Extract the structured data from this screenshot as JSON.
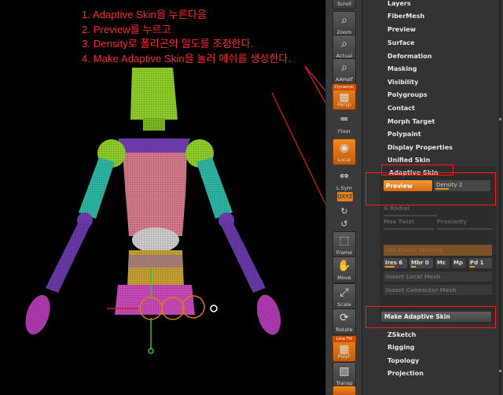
{
  "instructions": [
    "1. Adaptive Skin을 누른다음",
    "2. Preview를 누르고",
    "3. Density로 폴리곤의 밀도를 조정한다.",
    "4. Make Adaptive Skin을 눌러 메쉬를 생성한다."
  ],
  "shelf": {
    "top_label": "Scroll",
    "zoom": "Zoom",
    "actual": "Actual",
    "aahalf": "AAHalf",
    "persp_tag": "Dynamic",
    "persp": "Persp",
    "floor": "Floor",
    "local": "Local",
    "lsym": "L.Sym",
    "xyz": "QXYZ",
    "frame": "Frame",
    "move": "Move",
    "scale": "Scale",
    "rotate": "Rotate",
    "polyf_tag": "Line Fill",
    "polyf": "PolyF",
    "transp": "Transp"
  },
  "menu": {
    "items_top": [
      "Layers",
      "FiberMesh",
      "Preview",
      "Surface",
      "Deformation",
      "Masking",
      "Visibility",
      "Polygroups",
      "Contact",
      "Morph Target",
      "Polypaint",
      "Display Properties",
      "Unified Skin"
    ],
    "adaptive_title": "Adaptive Skin",
    "preview_button": "Preview",
    "density_label": "Density 2",
    "density_value": 0.25,
    "g_radial": "G Radial",
    "max_twist": "Max Twist",
    "proximity": "Proximity",
    "classic_skinning": "Use Classic Skinning",
    "ires_label": "Ires 6",
    "mbr_label": "Mbr 0",
    "mc_label": "Mc",
    "mp_label": "Mp",
    "pd_label": "Pd 1",
    "insert_local_mesh": "Insert Local Mesh",
    "insert_connector_mesh": "Insert Connector Mesh",
    "make_adaptive_skin": "Make Adaptive Skin",
    "items_bottom": [
      "ZSketch",
      "Rigging",
      "Topology",
      "Projection"
    ]
  },
  "colors": {
    "annotation": "#ff2a2a",
    "accent": "#f0901c",
    "head": "#8ecf2a",
    "torso": "#d47a8a",
    "arm_cyan": "#2fb7a6",
    "arm_purple": "#6a3aa8",
    "pelvis": "#c8a030"
  }
}
